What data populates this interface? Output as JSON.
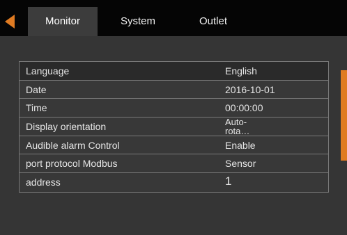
{
  "tabs": [
    {
      "label": "Monitor",
      "active": true
    },
    {
      "label": "System",
      "active": false
    },
    {
      "label": "Outlet",
      "active": false
    }
  ],
  "back_icon": "left-triangle-arrow",
  "accent_color": "#e07b22",
  "settings": [
    {
      "label": "Language",
      "value": "English"
    },
    {
      "label": "Date",
      "value": "2016-10-01"
    },
    {
      "label": "Time",
      "value": "00:00:00"
    },
    {
      "label": "Display orientation",
      "value": "Auto-\nrota…"
    },
    {
      "label": "Audible alarm Control",
      "value": "Enable"
    },
    {
      "label": "port protocol Modbus",
      "value": "Sensor"
    },
    {
      "label": "address",
      "value": "1"
    }
  ]
}
